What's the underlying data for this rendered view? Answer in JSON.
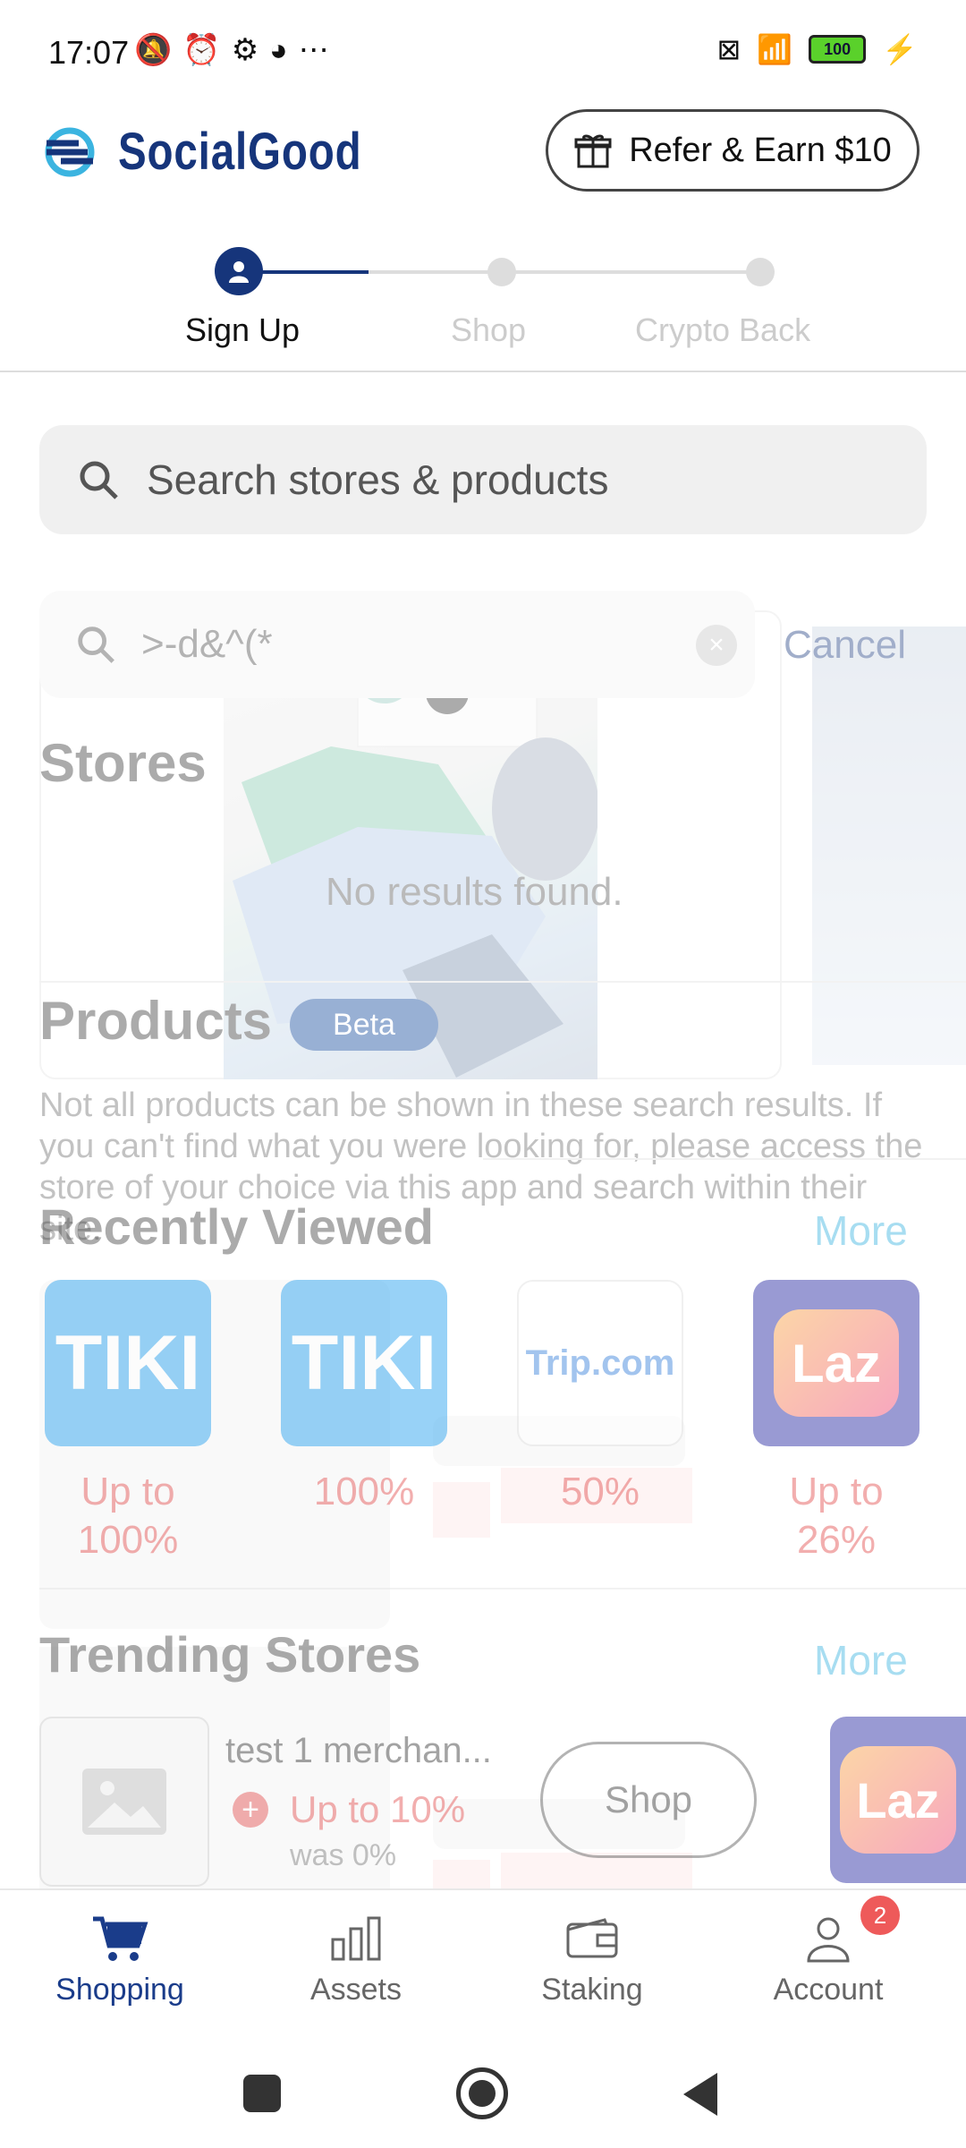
{
  "status_bar": {
    "time": "17:07",
    "icons": [
      "bell-off-icon",
      "alarm-icon",
      "gear-icon",
      "sync-icon",
      "more-dots-icon"
    ],
    "battery": "100"
  },
  "header": {
    "brand": "SocialGood",
    "refer_label": "Refer & Earn $10"
  },
  "stepper": {
    "steps": [
      "Sign Up",
      "Shop",
      "Crypto Back"
    ]
  },
  "search": {
    "placeholder": "Search stores & products"
  },
  "overlay_search": {
    "query": ">-d&^(*",
    "cancel_label": "Cancel",
    "stores_heading": "Stores",
    "no_results": "No results found.",
    "products_heading": "Products",
    "beta_label": "Beta",
    "disclaimer": "Not all products can be shown in these search results. If you can't find what you were looking for, please access the store of your choice via this app and search within their site."
  },
  "recently_viewed": {
    "heading": "Recently Viewed",
    "more_label": "More",
    "items": [
      {
        "logo": "TIKI",
        "offer": "Up to 100%"
      },
      {
        "logo": "TIKI",
        "offer": "100%"
      },
      {
        "logo": "Trip.com",
        "offer": "50%"
      },
      {
        "logo": "Laz",
        "offer": "Up to 26%"
      }
    ]
  },
  "trending_stores": {
    "heading": "Trending Stores",
    "more_label": "More",
    "item": {
      "name": "test 1 merchan...",
      "offer": "Up to 10%",
      "was": "was 0%",
      "shop_label": "Shop"
    },
    "next_logo": "Laz"
  },
  "bottom_nav": {
    "items": [
      {
        "label": "Shopping",
        "icon": "cart-icon"
      },
      {
        "label": "Assets",
        "icon": "bar-chart-icon"
      },
      {
        "label": "Staking",
        "icon": "wallet-icon"
      },
      {
        "label": "Account",
        "icon": "user-icon"
      }
    ],
    "account_badge": "2"
  },
  "colors": {
    "brand": "#16357b",
    "accent": "#3bb4e0",
    "offer": "#e24b4b"
  }
}
